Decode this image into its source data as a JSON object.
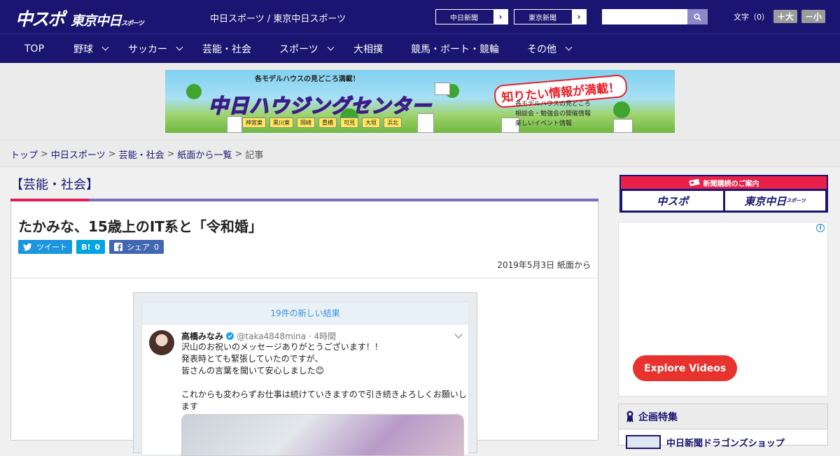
{
  "header": {
    "logo_main": "中スポ",
    "logo_sub": "東京中日",
    "logo_sub_small": "スポーツ",
    "site_title": "中日スポーツ / 東京中日スポーツ",
    "link1": "中日新聞",
    "link2": "東京新聞",
    "link_arrow": "›",
    "font_label": "文字（0）",
    "font_bigger": "＋大",
    "font_smaller": "－小"
  },
  "nav": {
    "items": [
      {
        "label": "TOP"
      },
      {
        "label": "野球"
      },
      {
        "label": "サッカー"
      },
      {
        "label": "芸能・社会"
      },
      {
        "label": "スポーツ"
      },
      {
        "label": "大相撲"
      },
      {
        "label": "競馬・ボート・競輪"
      },
      {
        "label": "その他"
      }
    ]
  },
  "banner": {
    "top_text": "各モデルハウスの見どころ満載！",
    "title": "中日ハウジングセンター",
    "catch": "知りたい情報が満載！",
    "list": [
      "各モデルハウスの見どころ",
      "相談会・勉強会の開催情報",
      "楽しいイベント情報"
    ],
    "cities": [
      "神宮東",
      "黒川東",
      "岡崎",
      "豊橋",
      "可児",
      "大垣",
      "浜北"
    ]
  },
  "breadcrumb": {
    "items": [
      "トップ",
      "中日スポーツ",
      "芸能・社会",
      "紙面から一覧"
    ],
    "current": "記事",
    "sep": ">"
  },
  "article": {
    "category": "【芸能・社会】",
    "title": "たかみな、15歳上のIT系と「令和婚」",
    "share_tweet": "ツイート",
    "share_hatena": "B!",
    "share_hatena_count": "0",
    "share_fb": "シェア",
    "share_fb_count": "0",
    "date": "2019年5月3日 紙面から"
  },
  "tweet": {
    "new_results": "19件の新しい結果",
    "name": "高橋みなみ",
    "handle": "@taka4848mina · 4時間",
    "lines": [
      "沢山のお祝いのメッセージありがとうございます！！",
      "発表時とても緊張していたのですが、",
      "皆さんの言葉を聞いて安心しました😊",
      "",
      "これからも変わらずお仕事は続けていきますので引き続きよろしくお願いします",
      "✨"
    ]
  },
  "sidebar": {
    "subscribe_title": "新聞購読のご案内",
    "sub_btn1": "中スポ",
    "sub_btn2": "東京中日",
    "sub_btn2_small": "スポーツ",
    "ad_info": "i",
    "explore": "Explore Videos",
    "feature_title": "企画特集",
    "feature_item": "中日新聞ドラゴンズショップ"
  }
}
